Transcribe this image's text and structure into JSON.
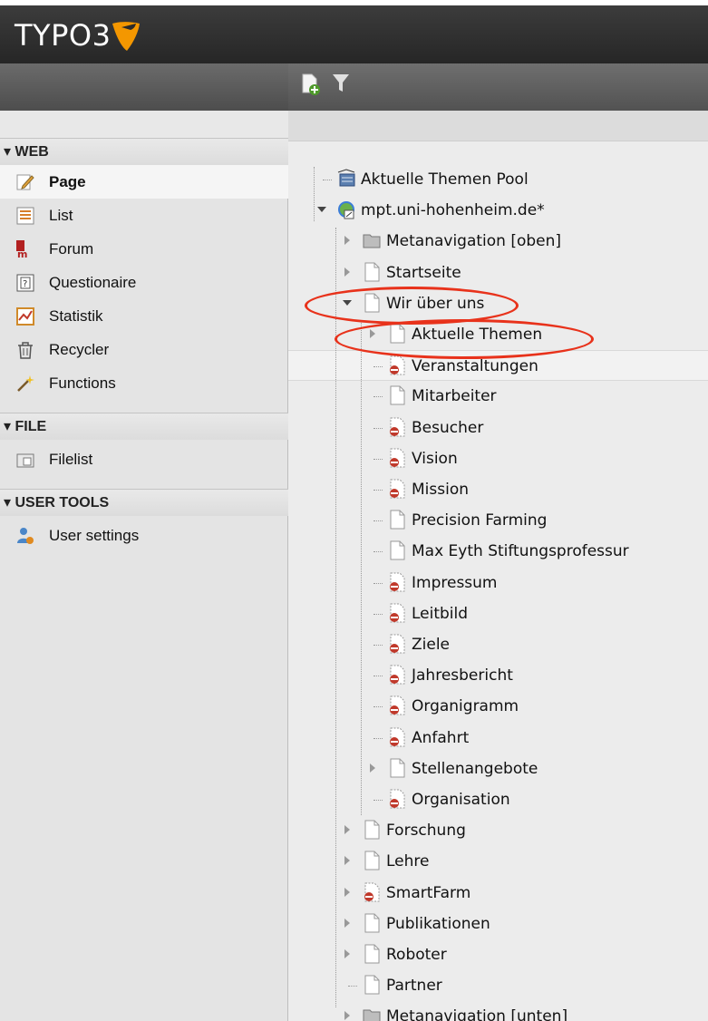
{
  "app": {
    "logo_text": "TYPO3"
  },
  "toolbar": {
    "new_page_icon": "new-page-icon",
    "filter_icon": "filter-icon"
  },
  "modules": [
    {
      "header": "▾ WEB",
      "items": [
        {
          "label": "Page",
          "icon": "page-edit-icon",
          "active": true
        },
        {
          "label": "List",
          "icon": "list-icon"
        },
        {
          "label": "Forum",
          "icon": "forum-icon"
        },
        {
          "label": "Questionaire",
          "icon": "questionaire-icon"
        },
        {
          "label": "Statistik",
          "icon": "statistik-icon"
        },
        {
          "label": "Recycler",
          "icon": "recycler-icon"
        },
        {
          "label": "Functions",
          "icon": "functions-icon"
        }
      ]
    },
    {
      "header": "▾ FILE",
      "items": [
        {
          "label": "Filelist",
          "icon": "filelist-icon"
        }
      ]
    },
    {
      "header": "▾ USER TOOLS",
      "items": [
        {
          "label": "User settings",
          "icon": "user-settings-icon"
        }
      ]
    }
  ],
  "tree": [
    {
      "label": "Aktuelle Themen Pool",
      "level": 0,
      "icon": "pool-icon",
      "toggle": "none"
    },
    {
      "label": "mpt.uni-hohenheim.de*",
      "level": 0,
      "icon": "globe-icon",
      "toggle": "open"
    },
    {
      "label": "Metanavigation [oben]",
      "level": 1,
      "icon": "folder-icon",
      "toggle": "closed"
    },
    {
      "label": "Startseite",
      "level": 1,
      "icon": "page-icon",
      "toggle": "closed"
    },
    {
      "label": "Wir über uns",
      "level": 1,
      "icon": "page-icon",
      "toggle": "open"
    },
    {
      "label": "Aktuelle Themen",
      "level": 2,
      "icon": "page-icon",
      "toggle": "closed"
    },
    {
      "label": "Veranstaltungen",
      "level": 2,
      "icon": "hidden-page-icon",
      "toggle": "none"
    },
    {
      "label": "Mitarbeiter",
      "level": 2,
      "icon": "page-icon",
      "toggle": "none"
    },
    {
      "label": "Besucher",
      "level": 2,
      "icon": "hidden-page-icon",
      "toggle": "none"
    },
    {
      "label": "Vision",
      "level": 2,
      "icon": "hidden-page-icon",
      "toggle": "none"
    },
    {
      "label": "Mission",
      "level": 2,
      "icon": "hidden-page-icon",
      "toggle": "none"
    },
    {
      "label": "Precision Farming",
      "level": 2,
      "icon": "page-icon",
      "toggle": "none"
    },
    {
      "label": "Max Eyth Stiftungsprofessur",
      "level": 2,
      "icon": "page-icon",
      "toggle": "none"
    },
    {
      "label": "Impressum",
      "level": 2,
      "icon": "hidden-page-icon",
      "toggle": "none"
    },
    {
      "label": "Leitbild",
      "level": 2,
      "icon": "hidden-page-icon",
      "toggle": "none"
    },
    {
      "label": "Ziele",
      "level": 2,
      "icon": "hidden-page-icon",
      "toggle": "none"
    },
    {
      "label": "Jahresbericht",
      "level": 2,
      "icon": "hidden-page-icon",
      "toggle": "none"
    },
    {
      "label": "Organigramm",
      "level": 2,
      "icon": "hidden-page-icon",
      "toggle": "none"
    },
    {
      "label": "Anfahrt",
      "level": 2,
      "icon": "hidden-page-icon",
      "toggle": "none"
    },
    {
      "label": "Stellenangebote",
      "level": 2,
      "icon": "page-icon",
      "toggle": "closed"
    },
    {
      "label": "Organisation",
      "level": 2,
      "icon": "hidden-page-icon",
      "toggle": "none"
    },
    {
      "label": "Forschung",
      "level": 1,
      "icon": "page-icon",
      "toggle": "closed"
    },
    {
      "label": "Lehre",
      "level": 1,
      "icon": "page-icon",
      "toggle": "closed"
    },
    {
      "label": "SmartFarm",
      "level": 1,
      "icon": "hidden-page-icon",
      "toggle": "closed"
    },
    {
      "label": "Publikationen",
      "level": 1,
      "icon": "page-icon",
      "toggle": "closed"
    },
    {
      "label": "Roboter",
      "level": 1,
      "icon": "page-icon",
      "toggle": "closed"
    },
    {
      "label": "Partner",
      "level": 1,
      "icon": "page-icon",
      "toggle": "none"
    },
    {
      "label": "Metanavigation [unten]",
      "level": 1,
      "icon": "folder-icon",
      "toggle": "closed"
    }
  ],
  "colors": {
    "annotation": "#e8321b",
    "logo_orange": "#f49700"
  }
}
